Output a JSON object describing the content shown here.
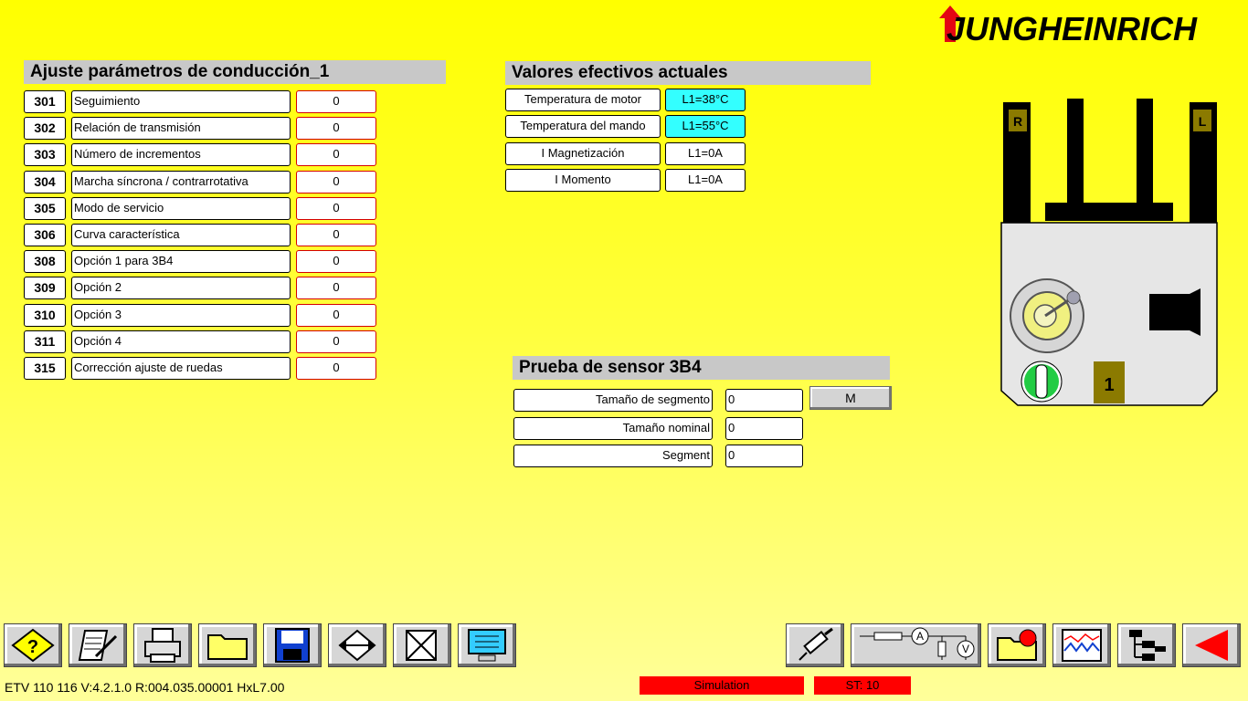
{
  "brand": {
    "logo_text": "JUNGHEINRICH"
  },
  "params": {
    "title": "Ajuste parámetros de conducción_1",
    "rows": [
      {
        "num": "301",
        "label": "Seguimiento",
        "value": "0"
      },
      {
        "num": "302",
        "label": "Relación de transmisión",
        "value": "0"
      },
      {
        "num": "303",
        "label": "Número de incrementos",
        "value": "0"
      },
      {
        "num": "304",
        "label": "Marcha síncrona / contrarrotativa",
        "value": "0"
      },
      {
        "num": "305",
        "label": "Modo de servicio",
        "value": "0"
      },
      {
        "num": "306",
        "label": "Curva característica",
        "value": "0"
      },
      {
        "num": "308",
        "label": "Opción  1 para 3B4",
        "value": "0"
      },
      {
        "num": "309",
        "label": "Opción  2",
        "value": "0"
      },
      {
        "num": "310",
        "label": "Opción  3",
        "value": "0"
      },
      {
        "num": "311",
        "label": "Opción  4",
        "value": "0"
      },
      {
        "num": "315",
        "label": "Corrección ajuste de ruedas",
        "value": "0"
      }
    ]
  },
  "actual": {
    "title": "Valores efectivos actuales",
    "rows": [
      {
        "label": "Temperatura de motor",
        "value": "L1=38°C",
        "highlight": true
      },
      {
        "label": "Temperatura del mando",
        "value": "L1=55°C",
        "highlight": true
      },
      {
        "label": "I  Magnetización",
        "value": "L1=0A",
        "highlight": false
      },
      {
        "label": "I  Momento",
        "value": "L1=0A",
        "highlight": false
      }
    ]
  },
  "sensor": {
    "title": "Prueba de sensor 3B4",
    "rows": [
      {
        "label": "Tamaño de  segmento",
        "value": "0"
      },
      {
        "label": "Tamaño  nominal",
        "value": "0"
      },
      {
        "label": "Segment",
        "value": "0"
      }
    ],
    "button_label": "M"
  },
  "truck": {
    "right_label": "R",
    "left_label": "L",
    "indicator": "1"
  },
  "toolbar_left": [
    "help-icon",
    "notepad-icon",
    "printer-icon",
    "folder-icon",
    "save-disk-icon",
    "data-transfer-icon",
    "crossed-document-icon",
    "monitor-icon"
  ],
  "toolbar_right": [
    "syringe-icon",
    "circuit-meter-icon",
    "folder-record-icon",
    "oscilloscope-icon",
    "tree-structure-icon",
    "back-arrow-icon"
  ],
  "status": {
    "version": "ETV  110  116 V:4.2.1.0 R:004.035.00001 HxL7.00",
    "simulation": "Simulation",
    "state": "ST: 10"
  },
  "colors": {
    "background": "#ffff00",
    "accent_red": "#ff0000",
    "highlight_cyan": "#33ffff",
    "brand_red": "#e30613"
  }
}
